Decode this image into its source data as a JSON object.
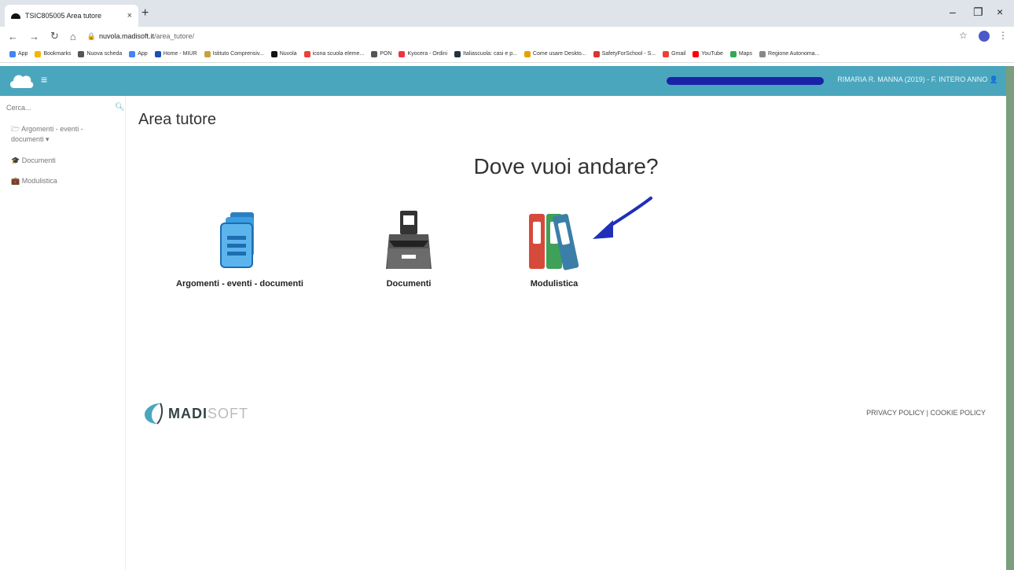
{
  "browser": {
    "tab_title": "TSIC805005 Area tutore",
    "url_host": "nuvola.madisoft.it",
    "url_path": "/area_tutore/",
    "bookmarks": [
      "App",
      "Bookmarks",
      "Nuova scheda",
      "App",
      "Home - MIUR",
      "Istituto Comprensiv...",
      "Nuvola",
      "icona scuola eleme...",
      "PON",
      "Kyocera - Ordini",
      "Italiascuola: casi e p...",
      "Come usare Deskto...",
      "SafetyForSchool - S...",
      "Gmail",
      "YouTube",
      "Maps",
      "Regione Autonoma..."
    ]
  },
  "header": {
    "user_label": "RIMARIA R. MANNA (2019) - F. INTERO ANNO"
  },
  "sidebar": {
    "search_placeholder": "Cerca...",
    "items": [
      {
        "label": "Argomenti - eventi - documenti"
      },
      {
        "label": "Documenti"
      },
      {
        "label": "Modulistica"
      }
    ]
  },
  "main": {
    "title": "Area tutore",
    "headline": "Dove vuoi andare?",
    "tiles": [
      {
        "label": "Argomenti - eventi - documenti"
      },
      {
        "label": "Documenti"
      },
      {
        "label": "Modulistica"
      }
    ]
  },
  "footer": {
    "brand_a": "MADI",
    "brand_b": "SOFT",
    "links": "PRIVACY POLICY | COOKIE POLICY"
  },
  "colors": {
    "topbar": "#4aa6bd",
    "accent": "#4aa6bd",
    "redaction": "#1a23a8"
  }
}
